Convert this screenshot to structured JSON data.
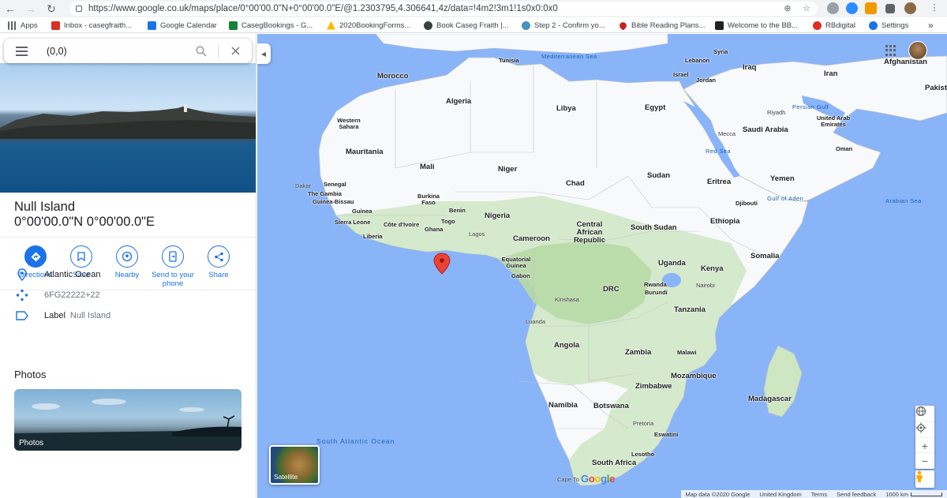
{
  "browser": {
    "url": "https://www.google.co.uk/maps/place/0°00'00.0\"N+0°00'00.0\"E/@1.2303795,4.306641,4z/data=!4m2!3m1!1s0x0:0x0",
    "bookmarks": [
      {
        "label": "Apps",
        "icon": "apps-grid-icon",
        "color": "#5f6368"
      },
      {
        "label": "Inbox - casegfraith...",
        "icon": "gmail-icon",
        "color": "#d93025"
      },
      {
        "label": "Google Calendar",
        "icon": "calendar-icon",
        "color": "#1a73e8"
      },
      {
        "label": "CasegBookings - G...",
        "icon": "sheets-icon",
        "color": "#188038"
      },
      {
        "label": "2020BookingForms...",
        "icon": "drive-icon",
        "color": "#fbbc04"
      },
      {
        "label": "Book Caseg Fraith |...",
        "icon": "globe-icon",
        "color": "#3c4043"
      },
      {
        "label": "Step 2 - Confirm yo...",
        "icon": "bird-icon",
        "color": "#4a90c2"
      },
      {
        "label": "Bible Reading Plans...",
        "icon": "heart-icon",
        "color": "#c5221f"
      },
      {
        "label": "Welcome to the BB...",
        "icon": "bbc-icon",
        "color": "#202124"
      },
      {
        "label": "RBdigital",
        "icon": "rb-icon",
        "color": "#d93025"
      },
      {
        "label": "Settings",
        "icon": "gear-icon",
        "color": "#1a73e8"
      }
    ],
    "bookmarks_more": "»"
  },
  "search": {
    "value": "(0,0)"
  },
  "place": {
    "name": "Null Island",
    "coordinates": "0°00'00.0\"N 0°00'00.0\"E",
    "actions": [
      {
        "label": "Directions",
        "icon": "directions-icon"
      },
      {
        "label": "Save",
        "icon": "bookmark-icon"
      },
      {
        "label": "Nearby",
        "icon": "nearby-icon"
      },
      {
        "label": "Send to your phone",
        "icon": "send-to-phone-icon"
      },
      {
        "label": "Share",
        "icon": "share-icon"
      }
    ],
    "info": {
      "location": "Atlantic Ocean",
      "plus_code": "6FG22222+22",
      "label_key": "Label",
      "label_value": "Null Island"
    },
    "photos_heading": "Photos",
    "photo_card_label": "Photos"
  },
  "map": {
    "countries": [
      "Morocco",
      "Algeria",
      "Libya",
      "Egypt",
      "Western Sahara",
      "Mauritania",
      "Mali",
      "Niger",
      "Chad",
      "Sudan",
      "Senegal",
      "The Gambia",
      "Guinea-Bissau",
      "Guinea",
      "Sierra Leone",
      "Liberia",
      "Côte d'Ivoire",
      "Ghana",
      "Togo",
      "Benin",
      "Burkina Faso",
      "Nigeria",
      "Cameroon",
      "Central African Republic",
      "South Sudan",
      "Eritrea",
      "Djibouti",
      "Ethiopia",
      "Somalia",
      "Kenya",
      "Uganda",
      "Rwanda",
      "Burundi",
      "Equatorial Guinea",
      "Gabon",
      "DRC",
      "Tanzania",
      "Angola",
      "Zambia",
      "Malawi",
      "Mozambique",
      "Zimbabwe",
      "Namibia",
      "Botswana",
      "Madagascar",
      "South Africa",
      "Eswatini",
      "Lesotho",
      "Tunisia",
      "Syria",
      "Lebanon",
      "Israel",
      "Jordan",
      "Iraq",
      "Iran",
      "Afghanistan",
      "Pakist",
      "Saudi Arabia",
      "Yemen",
      "Oman",
      "United Arab Emirates"
    ],
    "cities": [
      "Dakar",
      "Lagos",
      "Kinshasa",
      "Luanda",
      "Nairobi",
      "Mecca",
      "Riyadh",
      "Pretoria",
      "Cape To",
      "Kenya"
    ],
    "water": [
      "Mediterranean Sea",
      "Red Sea",
      "Persian Gulf",
      "Gulf of Aden",
      "Arabian Sea",
      "South Atlantic Ocean"
    ],
    "satellite_label": "Satellite",
    "logo": "Google",
    "footer": {
      "map_data": "Map data ©2020 Google",
      "region": "United Kingdom",
      "terms": "Terms",
      "feedback": "Send feedback",
      "scale": "1000 km"
    }
  }
}
